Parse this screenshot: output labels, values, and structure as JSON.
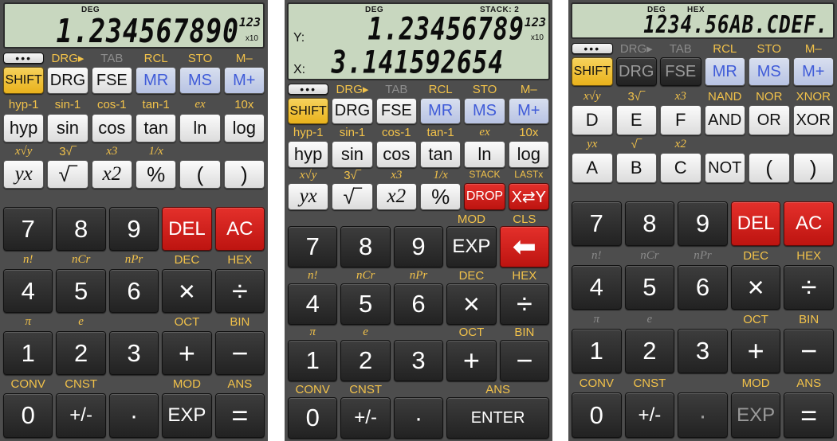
{
  "colors": {
    "accent_gold": "#f2c24a",
    "shift_gold": "#e9b21c",
    "red": "#d3201d",
    "blue_label": "#3f5bd8",
    "panel": "#4d4d4d",
    "lcd": "#c8d7bf"
  },
  "screens": [
    {
      "display": {
        "angle_mode": "DEG",
        "main": "1.234567890",
        "exponent_mult": "x10",
        "exponent": "123"
      },
      "top_labels_a": [
        "",
        "DRG▸",
        "TAB",
        "RCL",
        "STO",
        "M–"
      ],
      "keys_a": [
        "SHIFT",
        "DRG",
        "FSE",
        "MR",
        "MS",
        "M+"
      ],
      "top_labels_b": [
        "hyp-1",
        "sin-1",
        "cos-1",
        "tan-1",
        "ex",
        "10x"
      ],
      "keys_b": [
        "hyp",
        "sin",
        "cos",
        "tan",
        "ln",
        "log"
      ],
      "top_labels_c": [
        "x√y",
        "3√‾",
        "x3",
        "1/x",
        "",
        ""
      ],
      "keys_c": [
        "yx",
        "√‾",
        "x2",
        "%",
        "(",
        ")"
      ],
      "keys_row4": [
        "7",
        "8",
        "9",
        "DEL",
        "AC"
      ],
      "labels_row5": [
        "n!",
        "nCr",
        "nPr",
        "DEC",
        "HEX"
      ],
      "keys_row5": [
        "4",
        "5",
        "6",
        "×",
        "÷"
      ],
      "labels_row6": [
        "π",
        "e",
        "",
        "OCT",
        "BIN"
      ],
      "keys_row6": [
        "1",
        "2",
        "3",
        "+",
        "−"
      ],
      "labels_row7": [
        "CONV",
        "CNST",
        "",
        "MOD",
        "ANS"
      ],
      "keys_row7": [
        "0",
        "+/-",
        "·",
        "EXP",
        "="
      ]
    },
    {
      "display": {
        "angle_mode": "DEG",
        "stack": "STACK: 2",
        "y_label": "Y:",
        "x_label": "X:",
        "y_value": "1.23456789",
        "x_value": "3.141592654",
        "exponent_mult": "x10",
        "exponent": "123"
      },
      "top_labels_a": [
        "",
        "DRG▸",
        "TAB",
        "RCL",
        "STO",
        "M–"
      ],
      "keys_a": [
        "SHIFT",
        "DRG",
        "FSE",
        "MR",
        "MS",
        "M+"
      ],
      "top_labels_b": [
        "hyp-1",
        "sin-1",
        "cos-1",
        "tan-1",
        "ex",
        "10x"
      ],
      "keys_b": [
        "hyp",
        "sin",
        "cos",
        "tan",
        "ln",
        "log"
      ],
      "top_labels_c": [
        "x√y",
        "3√‾",
        "x3",
        "1/x",
        "STACK",
        "LASTx"
      ],
      "keys_c": [
        "yx",
        "√‾",
        "x2",
        "%",
        "DROP",
        "X⇄Y"
      ],
      "labels_row4": [
        "",
        "",
        "",
        "MOD",
        "CLS"
      ],
      "keys_row4": [
        "7",
        "8",
        "9",
        "EXP",
        "⬅"
      ],
      "labels_row5": [
        "n!",
        "nCr",
        "nPr",
        "DEC",
        "HEX"
      ],
      "keys_row5": [
        "4",
        "5",
        "6",
        "×",
        "÷"
      ],
      "labels_row6": [
        "π",
        "e",
        "",
        "OCT",
        "BIN"
      ],
      "keys_row6": [
        "1",
        "2",
        "3",
        "+",
        "−"
      ],
      "labels_row7": [
        "CONV",
        "CNST",
        "",
        "ANS",
        ""
      ],
      "keys_row7": [
        "0",
        "+/-",
        "·",
        "ENTER"
      ]
    },
    {
      "display": {
        "angle_mode": "DEG",
        "base_mode": "HEX",
        "main": "1234.56AB.CDEF."
      },
      "top_labels_a": [
        "",
        "DRG▸",
        "TAB",
        "RCL",
        "STO",
        "M–"
      ],
      "keys_a": [
        "SHIFT",
        "DRG",
        "FSE",
        "MR",
        "MS",
        "M+"
      ],
      "top_labels_b": [
        "x√y",
        "3√‾",
        "x3",
        "NAND",
        "NOR",
        "XNOR"
      ],
      "keys_b": [
        "D",
        "E",
        "F",
        "AND",
        "OR",
        "XOR"
      ],
      "top_labels_c": [
        "yx",
        "√‾",
        "x2",
        "",
        "",
        ""
      ],
      "keys_c": [
        "A",
        "B",
        "C",
        "NOT",
        "(",
        ")"
      ],
      "keys_row4": [
        "7",
        "8",
        "9",
        "DEL",
        "AC"
      ],
      "labels_row5": [
        "n!",
        "nCr",
        "nPr",
        "DEC",
        "HEX"
      ],
      "keys_row5": [
        "4",
        "5",
        "6",
        "×",
        "÷"
      ],
      "labels_row6": [
        "π",
        "e",
        "",
        "OCT",
        "BIN"
      ],
      "keys_row6": [
        "1",
        "2",
        "3",
        "+",
        "−"
      ],
      "labels_row7": [
        "CONV",
        "CNST",
        "",
        "MOD",
        "ANS"
      ],
      "keys_row7": [
        "0",
        "+/-",
        "·",
        "EXP",
        "="
      ]
    }
  ]
}
